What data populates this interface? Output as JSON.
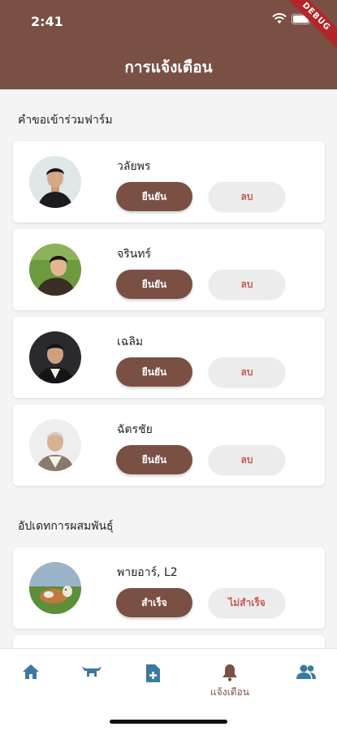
{
  "status_bar": {
    "time": "2:41",
    "debug_banner": "DEBUG"
  },
  "header": {
    "title": "การแจ้งเตือน"
  },
  "colors": {
    "brand": "#7a5045",
    "danger_text": "#c55b52",
    "background": "#f4f4f4"
  },
  "farm_requests": {
    "section_title": "คำขอเข้าร่วมฟาร์ม",
    "confirm_label": "ยืนยัน",
    "delete_label": "ลบ",
    "items": [
      {
        "name": "วลัยพร"
      },
      {
        "name": "จรินทร์"
      },
      {
        "name": "เฉลิม"
      },
      {
        "name": "ฉัตรชัย"
      }
    ]
  },
  "breeding_updates": {
    "section_title": "อัปเดทการผสมพันธุ์",
    "success_label": "สำเร็จ",
    "fail_label": "ไม่สำเร็จ",
    "items": [
      {
        "name": "พายอาร์, L2"
      }
    ]
  },
  "bottom_nav": {
    "items": [
      {
        "icon": "home-icon",
        "label": ""
      },
      {
        "icon": "cow-icon",
        "label": ""
      },
      {
        "icon": "add-document-icon",
        "label": ""
      },
      {
        "icon": "bell-icon",
        "label": "แจ้งเตือน",
        "active": true
      },
      {
        "icon": "group-icon",
        "label": ""
      }
    ]
  }
}
